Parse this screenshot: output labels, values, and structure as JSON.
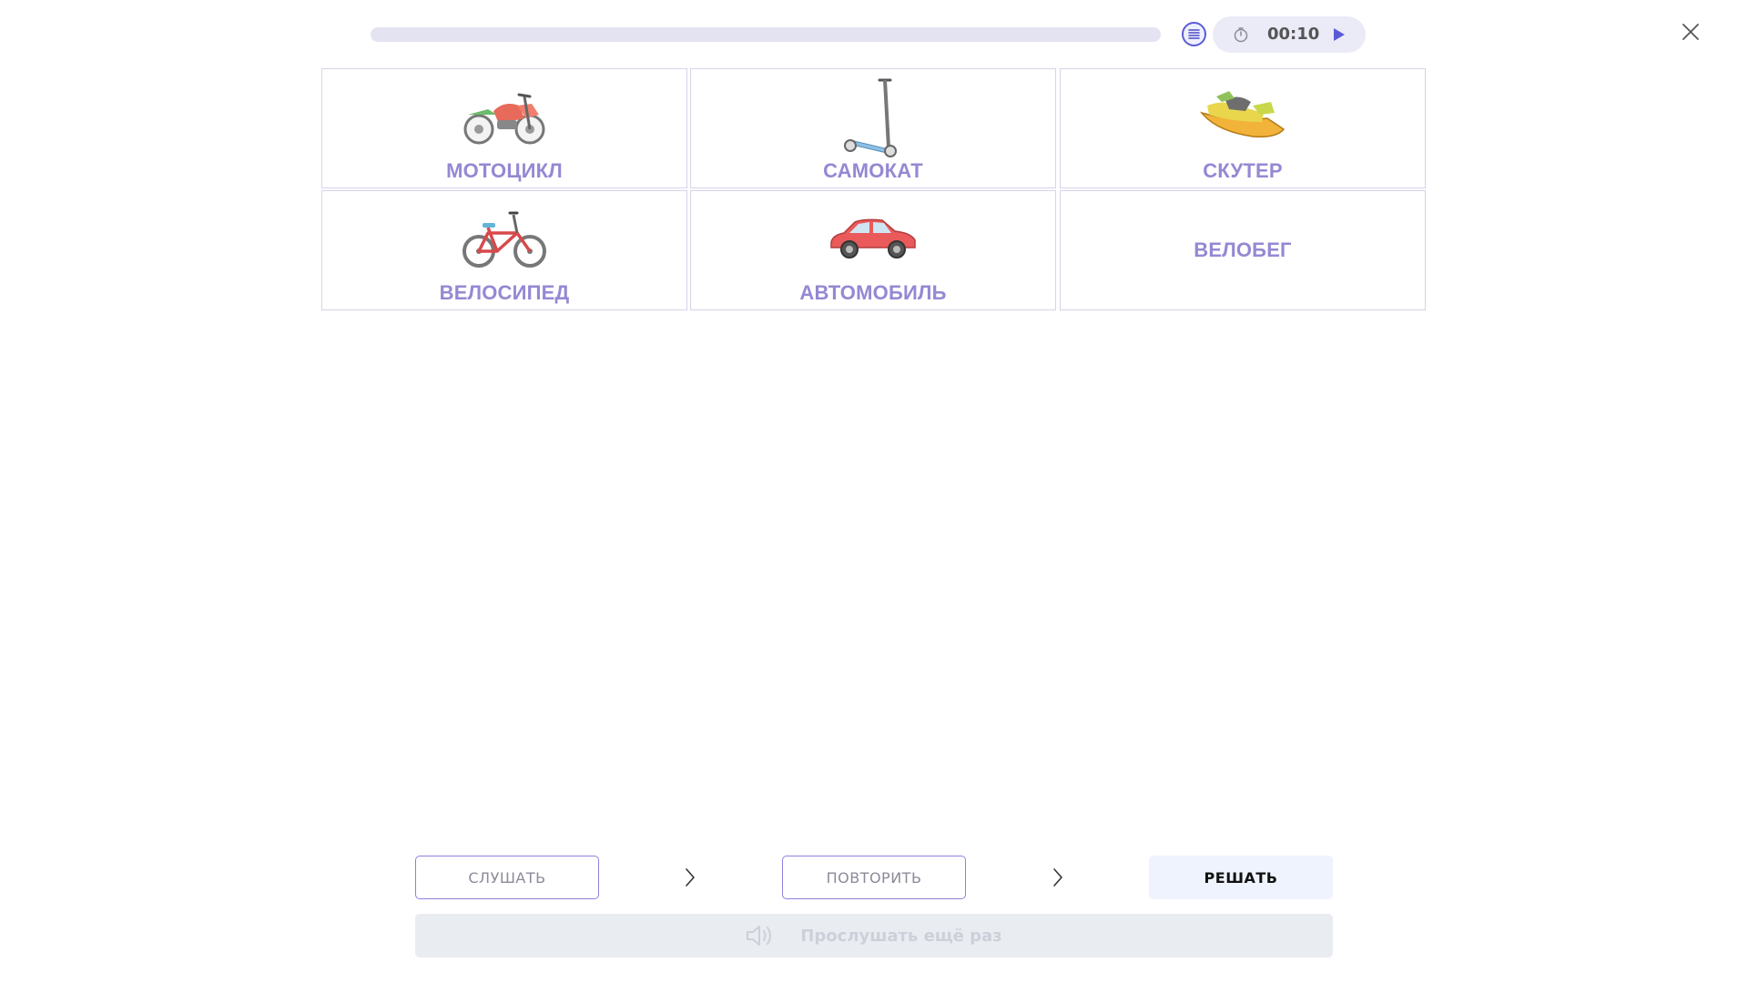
{
  "header": {
    "progress": 0,
    "timer": "00:10",
    "icons": {
      "list": "list-icon",
      "timer": "stopwatch-icon",
      "play": "play-icon",
      "close": "close-icon"
    }
  },
  "cards": [
    {
      "label": "МОТОЦИКЛ",
      "image": "motorcycle"
    },
    {
      "label": "САМОКАТ",
      "image": "kick-scooter"
    },
    {
      "label": "СКУТЕР",
      "image": "jet-ski"
    },
    {
      "label": "ВЕЛОСИПЕД",
      "image": "bicycle"
    },
    {
      "label": "АВТОМОБИЛЬ",
      "image": "car"
    },
    {
      "label": "ВЕЛОБЕГ",
      "image": null
    }
  ],
  "steps": {
    "listen": "СЛУШАТЬ",
    "repeat": "ПОВТОРИТЬ",
    "solve": "РЕШАТЬ"
  },
  "listen_again": {
    "label": "Прослушать ещё раз",
    "icon": "speaker-icon"
  },
  "colors": {
    "accent": "#9588d3",
    "card_border": "#d5d4ea",
    "solve_bg": "#eef3fd",
    "disabled_bg": "#e9ecf1"
  }
}
